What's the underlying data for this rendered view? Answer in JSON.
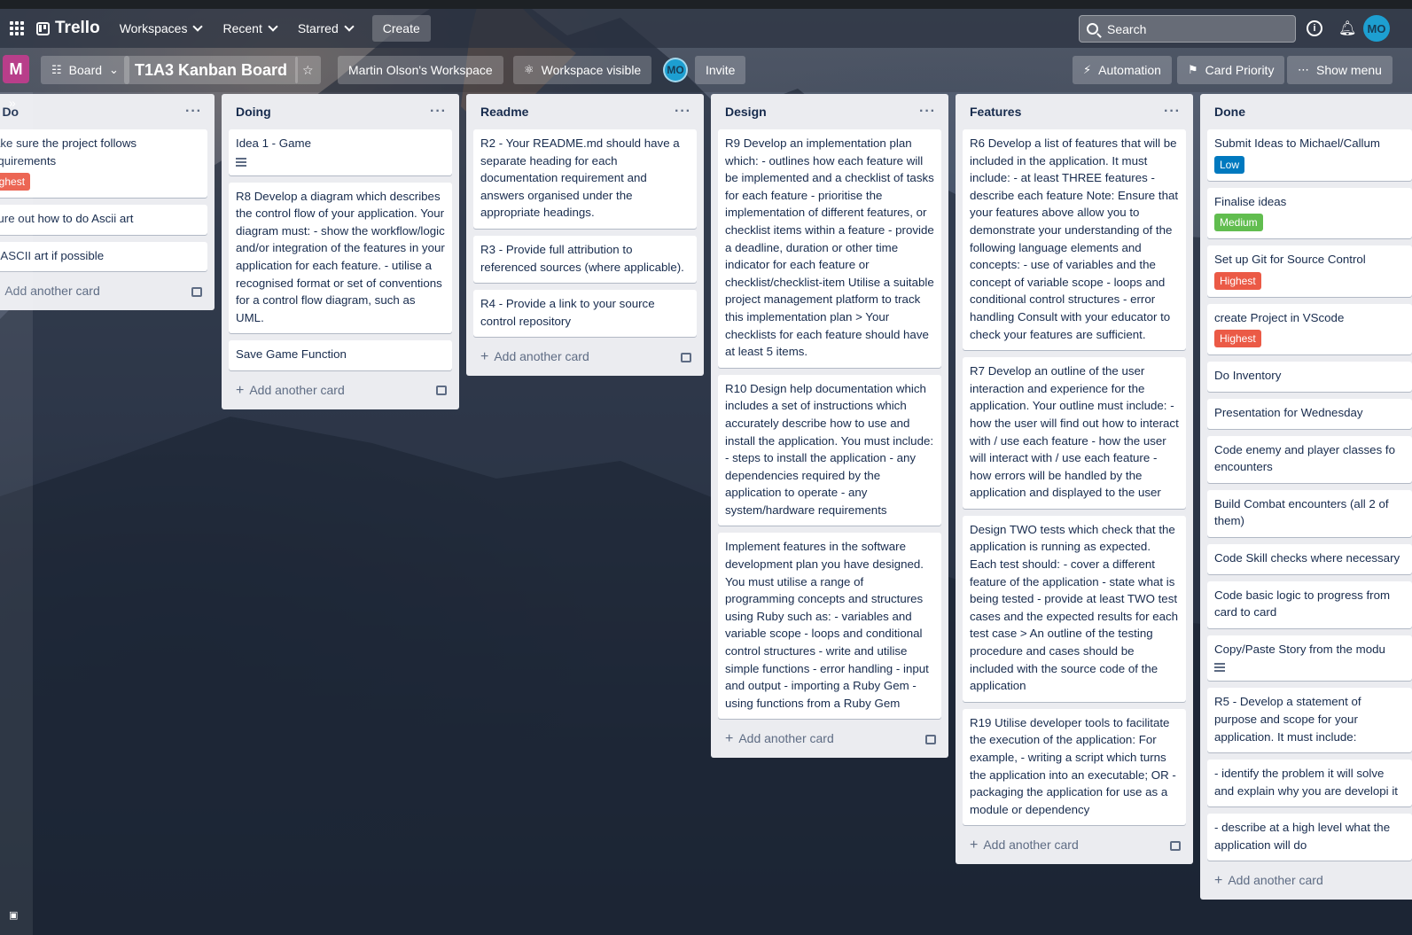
{
  "topnav": {
    "brand": "Trello",
    "menus": [
      "Workspaces",
      "Recent",
      "Starred"
    ],
    "create_label": "Create",
    "search_placeholder": "Search",
    "user_initials": "MO"
  },
  "boardbar": {
    "workspace_badge": "M",
    "view_label": "Board",
    "board_title": "T1A3 Kanban Board",
    "workspace_name": "Martin Olson's Workspace",
    "visibility_label": "Workspace visible",
    "member_initials": "MO",
    "invite_label": "Invite",
    "automation_label": "Automation",
    "card_priority_label": "Card Priority",
    "show_menu_label": "Show menu"
  },
  "colors": {
    "label_low": "#0079bf",
    "label_medium": "#61bd4f",
    "label_highest": "#eb5a46",
    "workspace_badge": "#b83e8a",
    "avatar": "#1d9fd1"
  },
  "add_card_label": "Add another card",
  "lists": [
    {
      "title": "o Do",
      "cards": [
        {
          "text": "lake sure the project follows equirements",
          "label": "ighest"
        },
        {
          "text": "gure out how to do Ascii art"
        },
        {
          "text": "o ASCII art if possible"
        }
      ]
    },
    {
      "title": "Doing",
      "cards": [
        {
          "text": "Idea 1 - Game",
          "has_description": true
        },
        {
          "text": "R8 Develop a diagram which describes the control flow of your application. Your diagram must: - show the workflow/logic and/or integration of the features in your application for each feature. - utilise a recognised format or set of conventions for a control flow diagram, such as UML."
        },
        {
          "text": "Save Game Function"
        }
      ]
    },
    {
      "title": "Readme",
      "cards": [
        {
          "text": "R2 - Your README.md should have a separate heading for each documentation requirement and answers organised under the appropriate headings."
        },
        {
          "text": "R3 - Provide full attribution to referenced sources (where applicable)."
        },
        {
          "text": "R4 - Provide a link to your source control repository"
        }
      ]
    },
    {
      "title": "Design",
      "cards": [
        {
          "text": "R9 Develop an implementation plan which: - outlines how each feature will be implemented and a checklist of tasks for each feature - prioritise the implementation of different features, or checklist items within a feature - provide a deadline, duration or other time indicator for each feature or checklist/checklist-item Utilise a suitable project management platform to track this implementation plan > Your checklists for each feature should have at least 5 items."
        },
        {
          "text": "R10 Design help documentation which includes a set of instructions which accurately describe how to use and install the application. You must include: - steps to install the application - any dependencies required by the application to operate - any system/hardware requirements"
        },
        {
          "text": "Implement features in the software development plan you have designed. You must utilise a range of programming concepts and structures using Ruby such as: - variables and variable scope - loops and conditional control structures - write and utilise simple functions - error handling - input and output - importing a Ruby Gem - using functions from a Ruby Gem"
        }
      ]
    },
    {
      "title": "Features",
      "cards": [
        {
          "text": "R6 Develop a list of features that will be included in the application. It must include: - at least THREE features - describe each feature Note: Ensure that your features above allow you to demonstrate your understanding of the following language elements and concepts: - use of variables and the concept of variable scope - loops and conditional control structures - error handling Consult with your educator to check your features are sufficient."
        },
        {
          "text": "R7 Develop an outline of the user interaction and experience for the application. Your outline must include: - how the user will find out how to interact with / use each feature - how the user will interact with / use each feature - how errors will be handled by the application and displayed to the user"
        },
        {
          "text": "Design TWO tests which check that the application is running as expected. Each test should: - cover a different feature of the application - state what is being tested - provide at least TWO test cases and the expected results for each test case > An outline of the testing procedure and cases should be included with the source code of the application"
        },
        {
          "text": "R19 Utilise developer tools to facilitate the execution of the application: For example, - writing a script which turns the application into an executable; OR - packaging the application for use as a module or dependency"
        }
      ]
    },
    {
      "title": "Done",
      "cards": [
        {
          "text": "Submit Ideas to Michael/Callum",
          "label": "Low"
        },
        {
          "text": "Finalise ideas",
          "label": "Medium"
        },
        {
          "text": "Set up Git for Source Control",
          "label": "Highest"
        },
        {
          "text": "create Project in VScode",
          "label": "Highest"
        },
        {
          "text": "Do Inventory"
        },
        {
          "text": "Presentation for Wednesday"
        },
        {
          "text": "Code enemy and player classes fo encounters"
        },
        {
          "text": "Build Combat encounters (all 2 of them)"
        },
        {
          "text": "Code Skill checks where necessary"
        },
        {
          "text": "Code basic logic to progress from card to card"
        },
        {
          "text": "Copy/Paste Story from the modu",
          "has_description": true
        },
        {
          "text": "R5 - Develop a statement of purpose and scope for your application. It must include:"
        },
        {
          "text": "- identify the problem it will solve and explain why you are developi it"
        },
        {
          "text": "- describe at a high level what the application will do"
        }
      ]
    }
  ]
}
